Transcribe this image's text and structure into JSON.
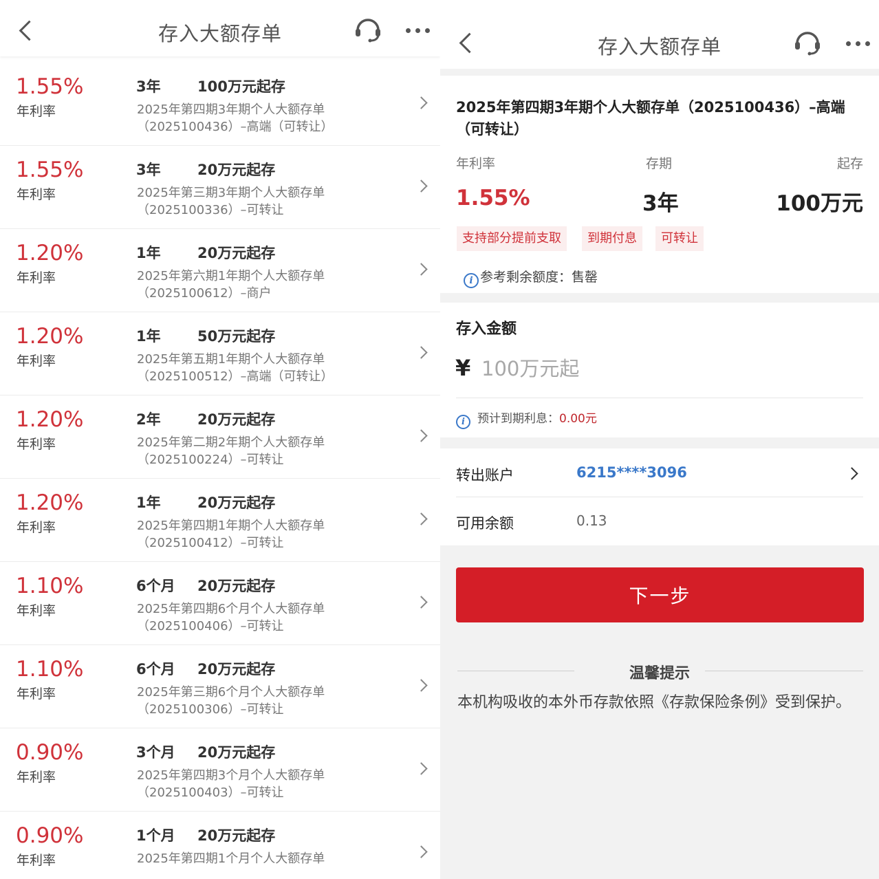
{
  "left": {
    "header": {
      "title": "存入大额存单"
    },
    "rate_label": "年利率",
    "items": [
      {
        "rate": "1.55%",
        "term": "3年",
        "min": "100万元起存",
        "name": "2025年第四期3年期个人大额存单（2025100436）–高端（可转让）"
      },
      {
        "rate": "1.55%",
        "term": "3年",
        "min": "20万元起存",
        "name": "2025年第三期3年期个人大额存单（2025100336）–可转让"
      },
      {
        "rate": "1.20%",
        "term": "1年",
        "min": "20万元起存",
        "name": "2025年第六期1年期个人大额存单（2025100612）–商户"
      },
      {
        "rate": "1.20%",
        "term": "1年",
        "min": "50万元起存",
        "name": "2025年第五期1年期个人大额存单（2025100512）–高端（可转让）"
      },
      {
        "rate": "1.20%",
        "term": "2年",
        "min": "20万元起存",
        "name": "2025年第二期2年期个人大额存单（2025100224）–可转让"
      },
      {
        "rate": "1.20%",
        "term": "1年",
        "min": "20万元起存",
        "name": "2025年第四期1年期个人大额存单（2025100412）–可转让"
      },
      {
        "rate": "1.10%",
        "term": "6个月",
        "min": "20万元起存",
        "name": "2025年第四期6个月个人大额存单（2025100406）–可转让"
      },
      {
        "rate": "1.10%",
        "term": "6个月",
        "min": "20万元起存",
        "name": "2025年第三期6个月个人大额存单（2025100306）–可转让"
      },
      {
        "rate": "0.90%",
        "term": "3个月",
        "min": "20万元起存",
        "name": "2025年第四期3个月个人大额存单（2025100403）–可转让"
      },
      {
        "rate": "0.90%",
        "term": "1个月",
        "min": "20万元起存",
        "name": "2025年第四期1个月个人大额存单"
      }
    ]
  },
  "right": {
    "header": {
      "title": "存入大额存单"
    },
    "product": {
      "title": "2025年第四期3年期个人大额存单（2025100436）–高端（可转让）",
      "rate_label": "年利率",
      "term_label": "存期",
      "min_label": "起存",
      "rate": "1.55%",
      "term": "3年",
      "min": "100万元",
      "tags": [
        "支持部分提前支取",
        "到期付息",
        "可转让"
      ],
      "quota_text": "参考剩余额度：售罄"
    },
    "deposit": {
      "title": "存入金额",
      "currency": "¥",
      "placeholder": "100万元起",
      "est_label": "预计到期利息：",
      "est_value": "0.00元"
    },
    "account": {
      "out_label": "转出账户",
      "out_value": "6215****3096",
      "balance_label": "可用余额",
      "balance_value": "0.13"
    },
    "next_button": "下一步",
    "tip": {
      "title": "温馨提示",
      "text": "本机构吸收的本外币存款依照《存款保险条例》受到保护。"
    }
  }
}
